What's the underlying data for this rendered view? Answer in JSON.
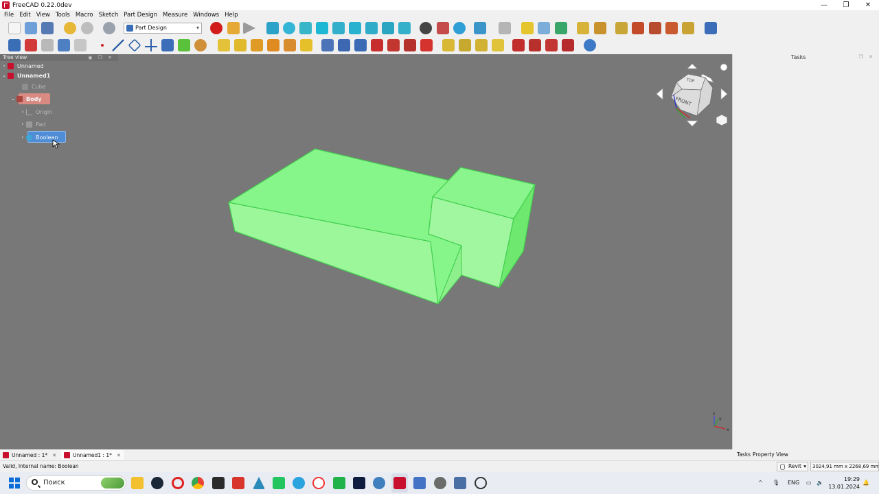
{
  "window": {
    "title": "FreeCAD 0.22.0dev",
    "controls": [
      "—",
      "❐",
      "✕"
    ]
  },
  "menu": [
    "File",
    "Edit",
    "View",
    "Tools",
    "Macro",
    "Sketch",
    "Part Design",
    "Measure",
    "Windows",
    "Help"
  ],
  "workbench": {
    "selected": "Part Design"
  },
  "tree": {
    "header": "Tree view",
    "items": [
      {
        "label": "Unnamed",
        "level": 0,
        "expanded": false
      },
      {
        "label": "Unnamed1",
        "level": 0,
        "expanded": true
      },
      {
        "label": "Cube",
        "level": 1
      },
      {
        "label": "Body",
        "level": 1,
        "expanded": true
      },
      {
        "label": "Origin",
        "level": 2
      },
      {
        "label": "Pad",
        "level": 2
      },
      {
        "label": "Boolean",
        "level": 2
      }
    ]
  },
  "tasks": {
    "title": "Tasks"
  },
  "navcube": {
    "top": "TOP",
    "front": "FRONT"
  },
  "axes": {
    "x": "x",
    "y": "y",
    "z": "z"
  },
  "doc_tabs": [
    {
      "label": "Unnamed : 1*"
    },
    {
      "label": "Unnamed1 : 1*"
    }
  ],
  "panel_tabs": [
    "Tasks",
    "Property View"
  ],
  "status": {
    "message": "Valid, Internal name: Boolean",
    "nav_style": "Revit",
    "dimensions": "3024,91 mm x 2268,69 mm"
  },
  "taskbar": {
    "search_placeholder": "Поиск",
    "language": "ENG",
    "time": "19:29",
    "date": "13.01.2024"
  },
  "colors": {
    "viewport_bg": "#787878",
    "solid_top": "#86f58a",
    "solid_front": "#9cf79a",
    "solid_side": "#6fe86f",
    "solid_edge": "#3bd34a",
    "body_highlight": "#d98b83",
    "selection": "#4f8ed6"
  }
}
